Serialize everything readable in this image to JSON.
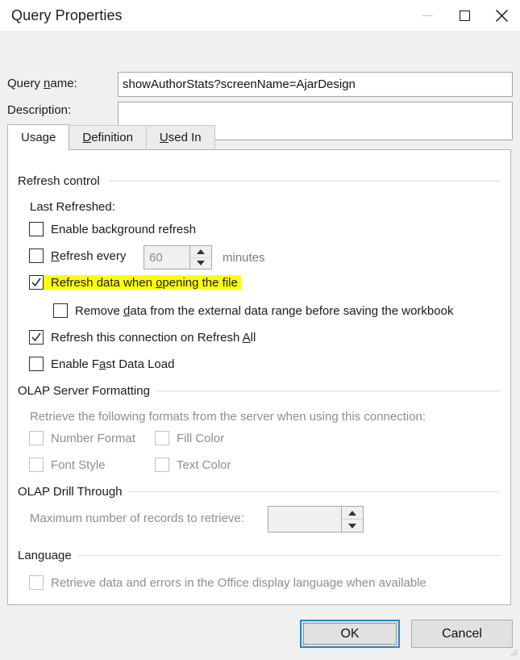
{
  "window": {
    "title": "Query Properties",
    "buttons": {
      "minimize": "minimize-icon",
      "maximize": "maximize-icon",
      "close": "close-icon"
    }
  },
  "header": {
    "query_name_label": "Query name:",
    "query_name_accel": "n",
    "query_name_value": "showAuthorStats?screenName=AjarDesign",
    "description_label": "Description:",
    "description_value": "",
    "description_placeholder": ""
  },
  "tabs": [
    {
      "label": "Usage",
      "accel": "",
      "active": true
    },
    {
      "label": "Definition",
      "accel": "D",
      "active": false
    },
    {
      "label": "Used In",
      "accel": "U",
      "active": false
    }
  ],
  "usage": {
    "refresh_control": {
      "group_label": "Refresh control",
      "last_refreshed_label": "Last Refreshed:",
      "options": [
        {
          "label": "Enable background refresh",
          "accel": "",
          "checked": false,
          "enabled": true,
          "highlighted": false
        },
        {
          "label": "Refresh every",
          "accel": "R",
          "checked": false,
          "enabled": true,
          "highlighted": false
        },
        {
          "label": "Refresh data when opening the file",
          "accel": "o",
          "checked": true,
          "enabled": true,
          "highlighted": true
        },
        {
          "label": "Remove data from the external data range before saving the workbook",
          "accel": "d",
          "checked": false,
          "enabled": true,
          "highlighted": false
        },
        {
          "label": "Refresh this connection on Refresh All",
          "accel": "A",
          "checked": true,
          "enabled": true,
          "highlighted": false
        },
        {
          "label": "Enable Fast Data Load",
          "accel": "a",
          "checked": false,
          "enabled": true,
          "highlighted": false
        }
      ],
      "interval_value": "60",
      "interval_units": "minutes"
    },
    "olap_server_formatting": {
      "group_label": "OLAP Server Formatting",
      "description": "Retrieve the following formats from the server when using this connection:",
      "options": [
        {
          "label": "Number Format",
          "checked": false,
          "enabled": false
        },
        {
          "label": "Fill Color",
          "checked": false,
          "enabled": false
        },
        {
          "label": "Font Style",
          "checked": false,
          "enabled": false
        },
        {
          "label": "Text Color",
          "checked": false,
          "enabled": false
        }
      ]
    },
    "olap_drill_through": {
      "group_label": "OLAP Drill Through",
      "max_records_label": "Maximum number of records to retrieve:",
      "max_records_value": ""
    },
    "language": {
      "group_label": "Language",
      "option": {
        "label": "Retrieve data and errors in the Office display language when available",
        "checked": false,
        "enabled": false
      }
    }
  },
  "footer": {
    "ok_label": "OK",
    "cancel_label": "Cancel"
  },
  "colors": {
    "highlight": "#ffff00",
    "focus_border": "#2686c8",
    "dialog_background": "#f0f0f0",
    "panel_background": "#ffffff"
  }
}
